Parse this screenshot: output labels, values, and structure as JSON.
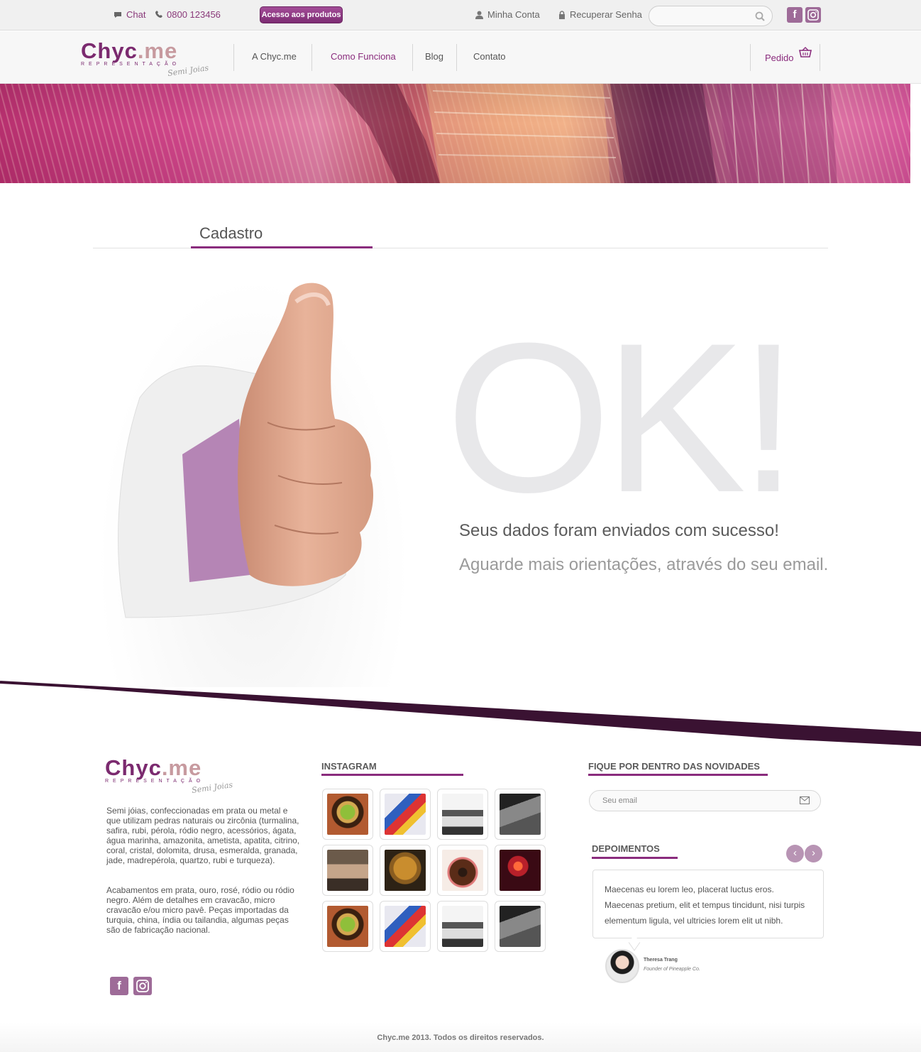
{
  "topbar": {
    "chat_label": "Chat",
    "phone": "0800 123456",
    "access_button": "Acesso aos produtos",
    "account_label": "Minha Conta",
    "recover_label": "Recuperar Senha",
    "search_placeholder": "",
    "social": [
      "f",
      "instagram"
    ]
  },
  "brand": {
    "logo_main": "Chyc",
    "logo_dot": ".me",
    "logo_sub": "REPRESENTAÇÃO",
    "logo_script": "Semi Joias"
  },
  "nav": {
    "items": [
      "A Chyc.me",
      "Como Funciona",
      "Blog",
      "Contato"
    ],
    "active": "Como Funciona",
    "cart_label": "Pedido"
  },
  "page": {
    "title": "Cadastro",
    "ok_text": "OK!",
    "message_primary": "Seus dados foram enviados com sucesso!",
    "message_secondary": "Aguarde mais orientações, através do seu email."
  },
  "footer": {
    "about_p1": "Semi jóias, confeccionadas em prata ou metal e que utilizam pedras naturais ou zircônia (turmalina, safira, rubi, pérola, ródio negro, acessórios, ágata, água marinha, amazonita, ametista, apatita, citrino, coral, cristal, dolomita, drusa, esmeralda, granada, jade, madrepérola, quartzo, rubi e turqueza).",
    "about_p2": "Acabamentos em prata, ouro, rosé, ródio ou ródio negro. Além de detalhes em cravacão, micro cravacão e/ou micro pavê. Peças importadas da turquia, china, índia ou tailandia, algumas peças são de fabricação nacional.",
    "instagram_title": "INSTAGRAM",
    "newsletter_title": "FIQUE POR DENTRO DAS NOVIDADES",
    "newsletter_placeholder": "Seu email",
    "testimonials_title": "DEPOIMENTOS",
    "testimonial_text": "Maecenas eu lorem leo, placerat luctus eros. Maecenas pretium, elit et tempus tincidunt, nisi turpis elementum ligula, vel ultricies lorem elit ut nibh.",
    "testimonial_name": "Theresa Trang",
    "testimonial_role": "Founder of Pineapple Co.",
    "copyright": "Chyc.me 2013. Todos os direitos reservados."
  },
  "colors": {
    "brand_purple": "#8a2c7d",
    "accent_pink": "#c79a9f",
    "ok_gray": "#e8e8ea",
    "footer_band": "#3a1232"
  },
  "instagram_photos": [
    "kiwi",
    "toys",
    "room-bw",
    "room-gray",
    "interior",
    "teddy-bear",
    "donut",
    "candle",
    "kiwi",
    "toys",
    "room-bw",
    "room-gray"
  ]
}
